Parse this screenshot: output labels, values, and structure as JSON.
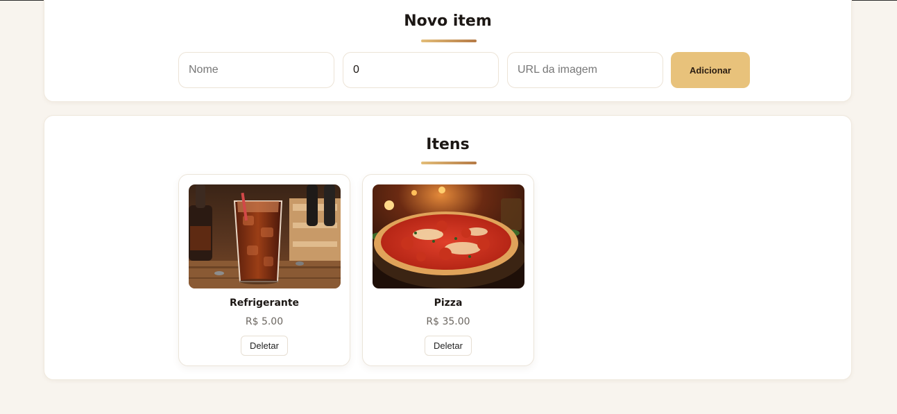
{
  "new_item": {
    "title": "Novo item",
    "name_placeholder": "Nome",
    "price_value": "0",
    "image_placeholder": "URL da imagem",
    "add_label": "Adicionar"
  },
  "items_section": {
    "title": "Itens",
    "items": [
      {
        "name": "Refrigerante",
        "price": "R$ 5.00",
        "delete_label": "Deletar",
        "image": "soda-glass-photo"
      },
      {
        "name": "Pizza",
        "price": "R$ 35.00",
        "delete_label": "Deletar",
        "image": "pizza-photo"
      }
    ]
  },
  "colors": {
    "background": "#f8f4ee",
    "accent": "#e8c27b",
    "underline_start": "#e3bd78",
    "underline_end": "#b57a45"
  }
}
